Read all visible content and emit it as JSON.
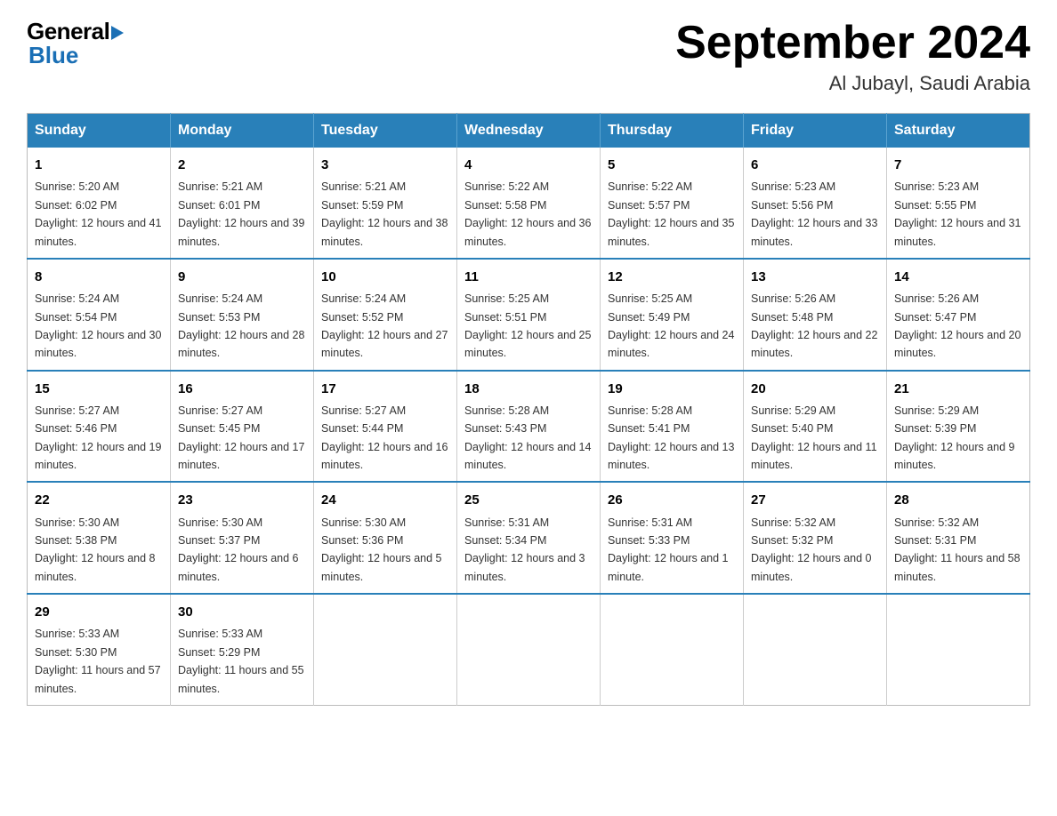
{
  "header": {
    "logo_general": "General",
    "logo_blue": "Blue",
    "month_title": "September 2024",
    "location": "Al Jubayl, Saudi Arabia"
  },
  "weekdays": [
    "Sunday",
    "Monday",
    "Tuesday",
    "Wednesday",
    "Thursday",
    "Friday",
    "Saturday"
  ],
  "weeks": [
    [
      {
        "day": "1",
        "sunrise": "5:20 AM",
        "sunset": "6:02 PM",
        "daylight": "12 hours and 41 minutes."
      },
      {
        "day": "2",
        "sunrise": "5:21 AM",
        "sunset": "6:01 PM",
        "daylight": "12 hours and 39 minutes."
      },
      {
        "day": "3",
        "sunrise": "5:21 AM",
        "sunset": "5:59 PM",
        "daylight": "12 hours and 38 minutes."
      },
      {
        "day": "4",
        "sunrise": "5:22 AM",
        "sunset": "5:58 PM",
        "daylight": "12 hours and 36 minutes."
      },
      {
        "day": "5",
        "sunrise": "5:22 AM",
        "sunset": "5:57 PM",
        "daylight": "12 hours and 35 minutes."
      },
      {
        "day": "6",
        "sunrise": "5:23 AM",
        "sunset": "5:56 PM",
        "daylight": "12 hours and 33 minutes."
      },
      {
        "day": "7",
        "sunrise": "5:23 AM",
        "sunset": "5:55 PM",
        "daylight": "12 hours and 31 minutes."
      }
    ],
    [
      {
        "day": "8",
        "sunrise": "5:24 AM",
        "sunset": "5:54 PM",
        "daylight": "12 hours and 30 minutes."
      },
      {
        "day": "9",
        "sunrise": "5:24 AM",
        "sunset": "5:53 PM",
        "daylight": "12 hours and 28 minutes."
      },
      {
        "day": "10",
        "sunrise": "5:24 AM",
        "sunset": "5:52 PM",
        "daylight": "12 hours and 27 minutes."
      },
      {
        "day": "11",
        "sunrise": "5:25 AM",
        "sunset": "5:51 PM",
        "daylight": "12 hours and 25 minutes."
      },
      {
        "day": "12",
        "sunrise": "5:25 AM",
        "sunset": "5:49 PM",
        "daylight": "12 hours and 24 minutes."
      },
      {
        "day": "13",
        "sunrise": "5:26 AM",
        "sunset": "5:48 PM",
        "daylight": "12 hours and 22 minutes."
      },
      {
        "day": "14",
        "sunrise": "5:26 AM",
        "sunset": "5:47 PM",
        "daylight": "12 hours and 20 minutes."
      }
    ],
    [
      {
        "day": "15",
        "sunrise": "5:27 AM",
        "sunset": "5:46 PM",
        "daylight": "12 hours and 19 minutes."
      },
      {
        "day": "16",
        "sunrise": "5:27 AM",
        "sunset": "5:45 PM",
        "daylight": "12 hours and 17 minutes."
      },
      {
        "day": "17",
        "sunrise": "5:27 AM",
        "sunset": "5:44 PM",
        "daylight": "12 hours and 16 minutes."
      },
      {
        "day": "18",
        "sunrise": "5:28 AM",
        "sunset": "5:43 PM",
        "daylight": "12 hours and 14 minutes."
      },
      {
        "day": "19",
        "sunrise": "5:28 AM",
        "sunset": "5:41 PM",
        "daylight": "12 hours and 13 minutes."
      },
      {
        "day": "20",
        "sunrise": "5:29 AM",
        "sunset": "5:40 PM",
        "daylight": "12 hours and 11 minutes."
      },
      {
        "day": "21",
        "sunrise": "5:29 AM",
        "sunset": "5:39 PM",
        "daylight": "12 hours and 9 minutes."
      }
    ],
    [
      {
        "day": "22",
        "sunrise": "5:30 AM",
        "sunset": "5:38 PM",
        "daylight": "12 hours and 8 minutes."
      },
      {
        "day": "23",
        "sunrise": "5:30 AM",
        "sunset": "5:37 PM",
        "daylight": "12 hours and 6 minutes."
      },
      {
        "day": "24",
        "sunrise": "5:30 AM",
        "sunset": "5:36 PM",
        "daylight": "12 hours and 5 minutes."
      },
      {
        "day": "25",
        "sunrise": "5:31 AM",
        "sunset": "5:34 PM",
        "daylight": "12 hours and 3 minutes."
      },
      {
        "day": "26",
        "sunrise": "5:31 AM",
        "sunset": "5:33 PM",
        "daylight": "12 hours and 1 minute."
      },
      {
        "day": "27",
        "sunrise": "5:32 AM",
        "sunset": "5:32 PM",
        "daylight": "12 hours and 0 minutes."
      },
      {
        "day": "28",
        "sunrise": "5:32 AM",
        "sunset": "5:31 PM",
        "daylight": "11 hours and 58 minutes."
      }
    ],
    [
      {
        "day": "29",
        "sunrise": "5:33 AM",
        "sunset": "5:30 PM",
        "daylight": "11 hours and 57 minutes."
      },
      {
        "day": "30",
        "sunrise": "5:33 AM",
        "sunset": "5:29 PM",
        "daylight": "11 hours and 55 minutes."
      },
      null,
      null,
      null,
      null,
      null
    ]
  ]
}
